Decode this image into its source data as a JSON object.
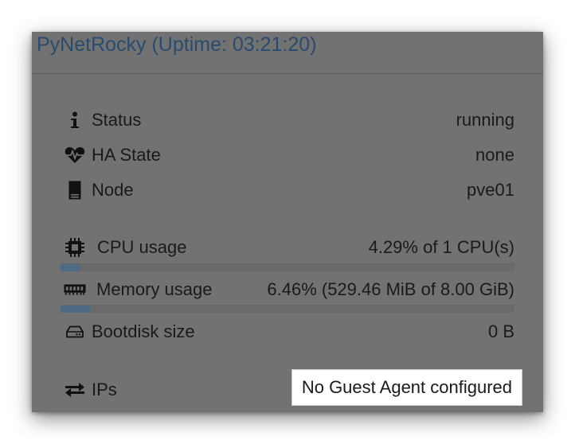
{
  "panel": {
    "title": "PyNetRocky (Uptime: 03:21:20)"
  },
  "rows": {
    "status": {
      "icon": "info-icon",
      "label": "Status",
      "value": "running"
    },
    "ha_state": {
      "icon": "heartbeat-icon",
      "label": "HA State",
      "value": "none"
    },
    "node": {
      "icon": "server-icon",
      "label": "Node",
      "value": "pve01"
    },
    "cpu": {
      "icon": "cpu-chip-icon",
      "label": "CPU usage",
      "value": "4.29% of 1 CPU(s)",
      "percent": 4.29
    },
    "memory": {
      "icon": "memory-icon",
      "label": "Memory usage",
      "value": "6.46% (529.46 MiB of 8.00 GiB)",
      "percent": 6.46
    },
    "bootdisk": {
      "icon": "hdd-icon",
      "label": "Bootdisk size",
      "value": "0 B"
    },
    "ips": {
      "icon": "exchange-icon",
      "label": "IPs",
      "value": "No Guest Agent configured"
    }
  },
  "colors": {
    "panel_bg": "#727272",
    "title": "#2a4a6e",
    "bar_fill": "#4f6a85"
  }
}
